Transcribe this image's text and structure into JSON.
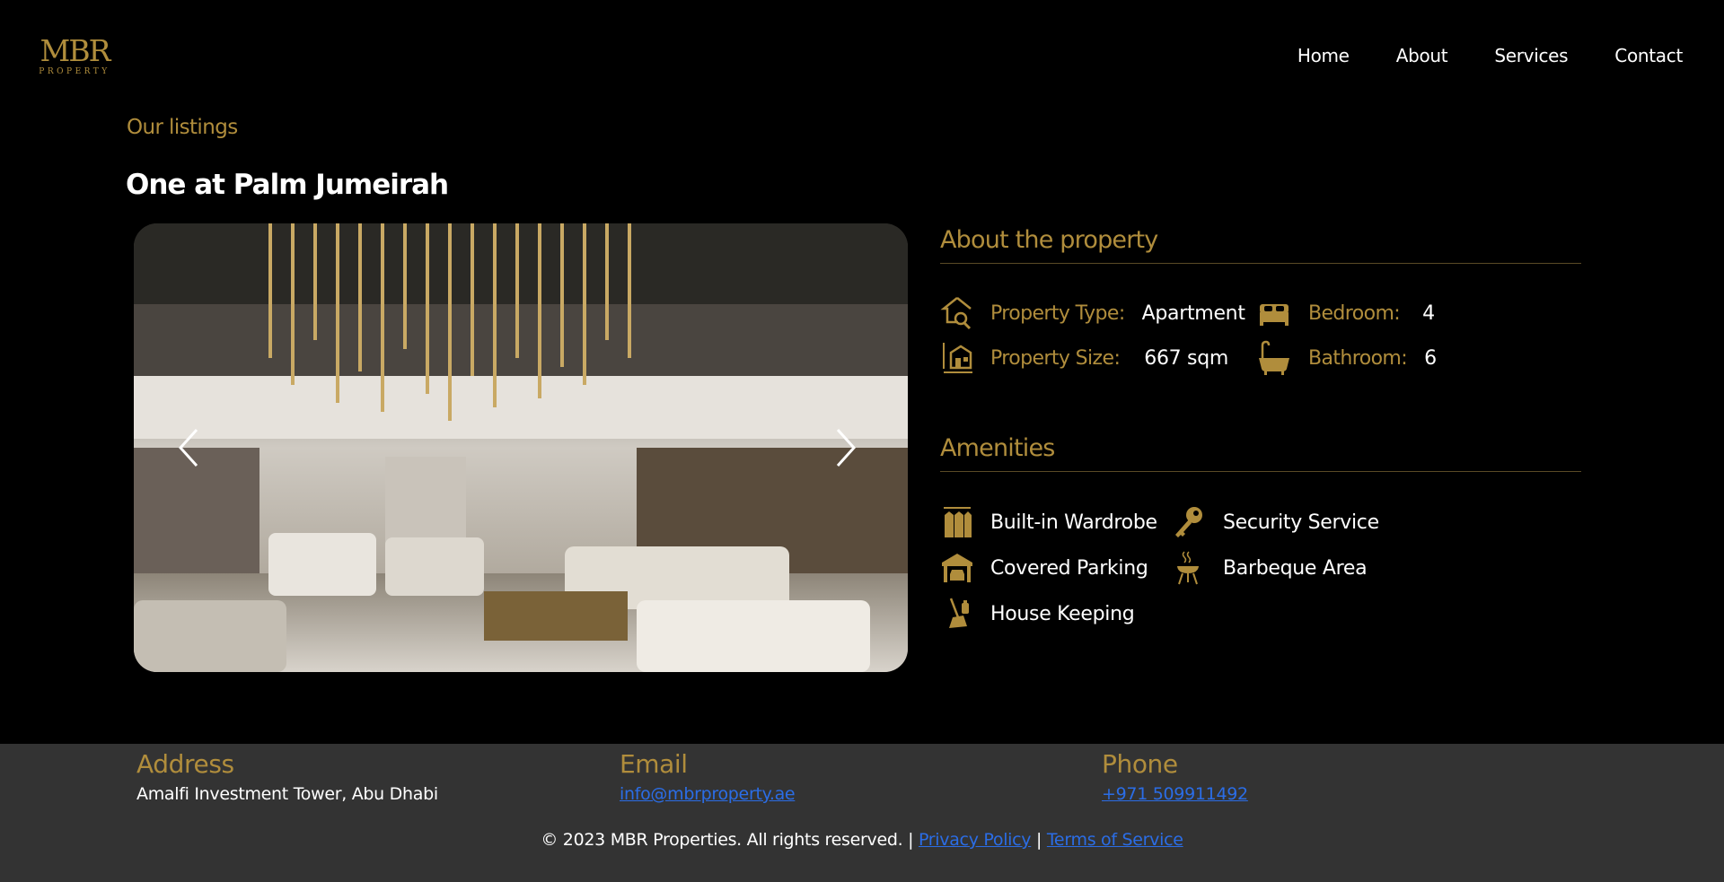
{
  "header": {
    "logo_mark": "MBR",
    "logo_sub": "PROPERTY",
    "nav": [
      "Home",
      "About",
      "Services",
      "Contact"
    ]
  },
  "page": {
    "eyebrow": "Our listings",
    "title": "One at Palm Jumeirah"
  },
  "about": {
    "heading": "About the property",
    "property_type_label": "Property Type:",
    "property_type_value": "Apartment",
    "bedroom_label": "Bedroom:",
    "bedroom_value": "4",
    "property_size_label": "Property Size:",
    "property_size_value": "667 sqm",
    "bathroom_label": "Bathroom:",
    "bathroom_value": "6"
  },
  "amenities": {
    "heading": "Amenities",
    "items": [
      "Built-in Wardrobe",
      "Security Service",
      "Covered Parking",
      "Barbeque Area",
      "House Keeping"
    ]
  },
  "footer": {
    "address_heading": "Address",
    "address_value": "Amalfi Investment Tower, Abu Dhabi",
    "email_heading": "Email",
    "email_value": "info@mbrproperty.ae",
    "phone_heading": "Phone",
    "phone_value": "+971 509911492",
    "copyright": "© 2023 MBR Properties. All rights reserved. |",
    "privacy": "Privacy Policy",
    "separator": "|",
    "terms": "Terms of Service"
  },
  "colors": {
    "accent": "#b08d3c",
    "background": "#000000",
    "footer_bg": "#333333",
    "link": "#2b6de6"
  }
}
